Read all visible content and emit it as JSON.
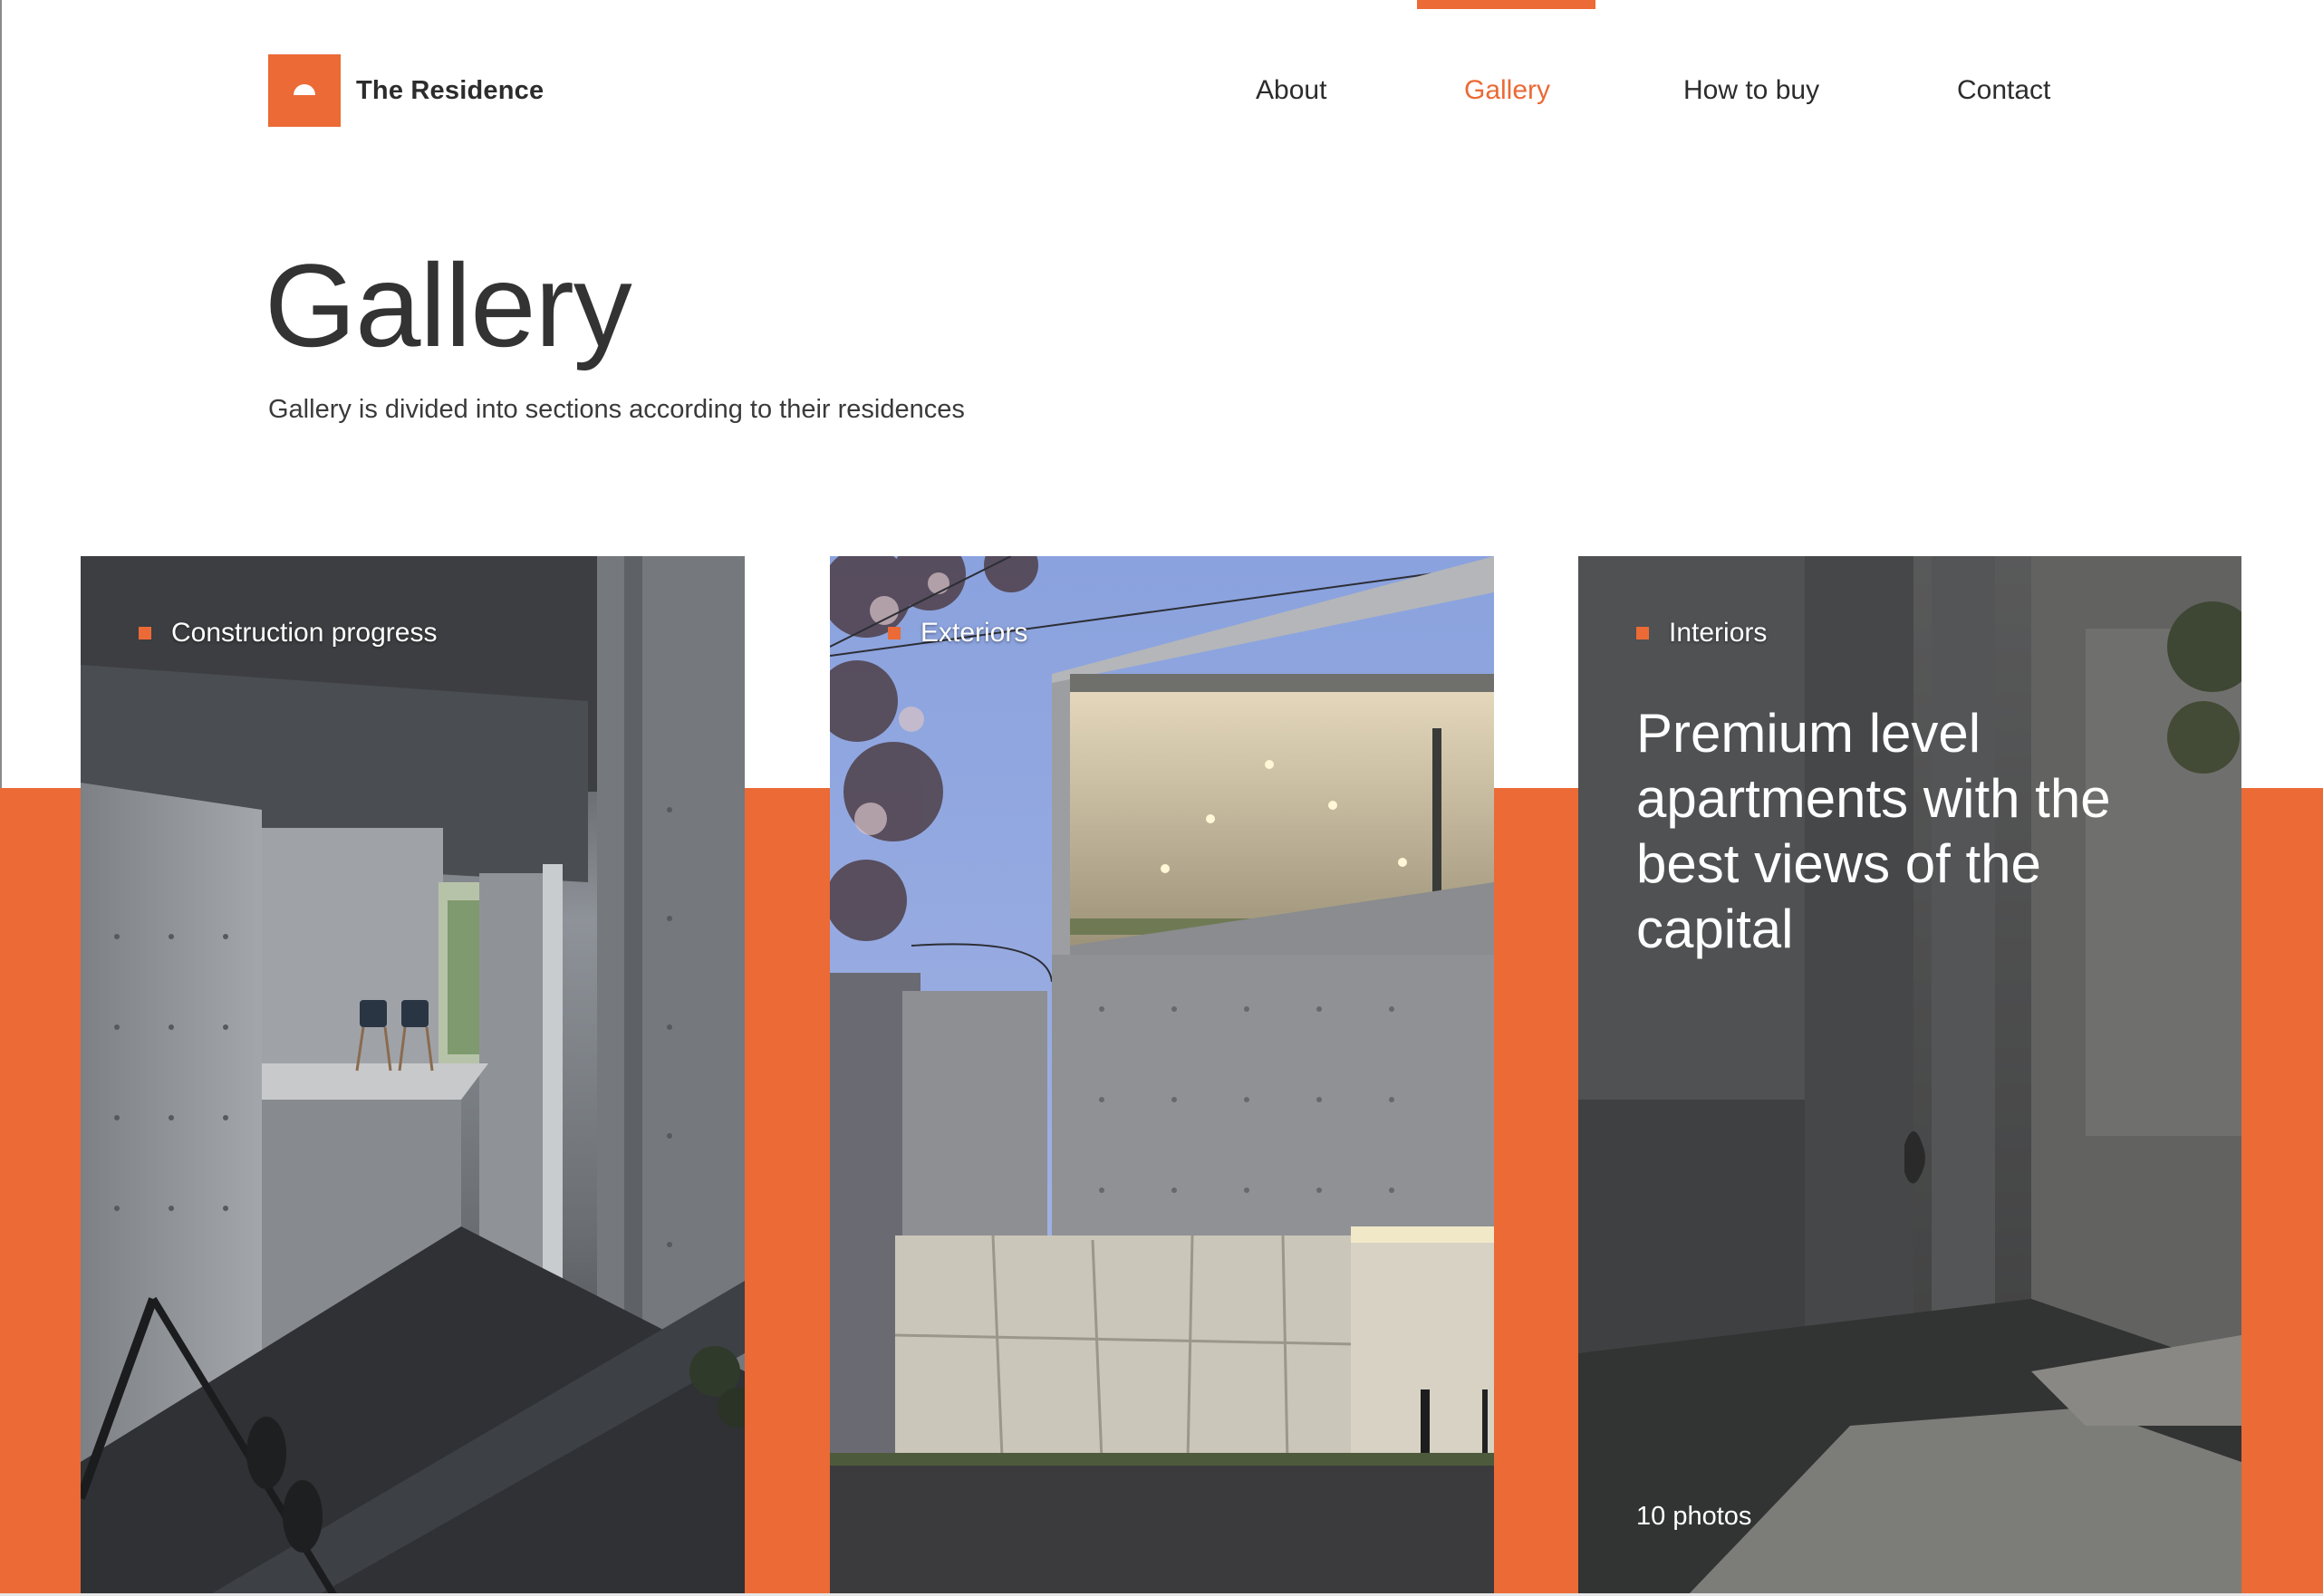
{
  "brand": {
    "name": "The Residence",
    "accent_color": "#eb6a36"
  },
  "nav": {
    "items": [
      {
        "label": "About"
      },
      {
        "label": "Gallery",
        "active": true
      },
      {
        "label": "How to buy"
      },
      {
        "label": "Contact"
      }
    ]
  },
  "page": {
    "title": "Gallery",
    "subtitle": "Gallery is divided into sections according to their residences"
  },
  "cards": [
    {
      "label": "Construction progress",
      "icon": "square-bullet-icon"
    },
    {
      "label": "Exteriors",
      "icon": "square-bullet-icon"
    },
    {
      "label": "Interiors",
      "icon": "square-bullet-icon",
      "headline": "Premium level apartments with the best views of the capital",
      "photo_count": "10 photos"
    }
  ]
}
